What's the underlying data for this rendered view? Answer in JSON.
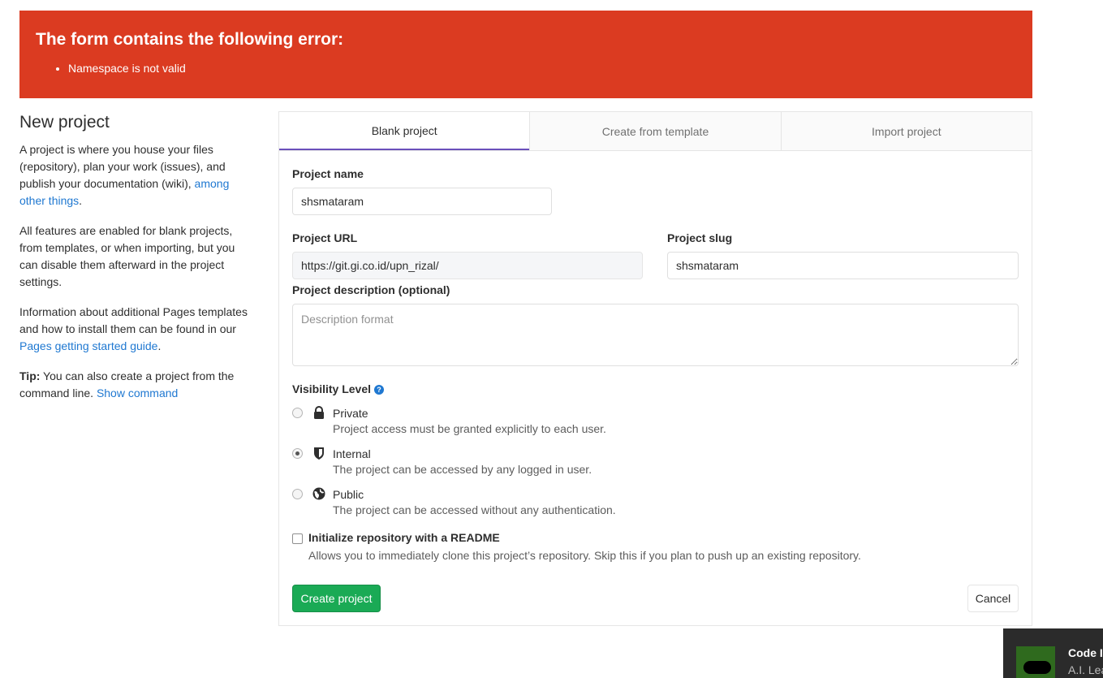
{
  "error": {
    "title": "The form contains the following error:",
    "items": [
      "Namespace is not valid"
    ]
  },
  "intro": {
    "title": "New project",
    "p1_text": "A project is where you house your files (repository), plan your work (issues), and publish your documentation (wiki), ",
    "p1_link": "among other things",
    "p1_end": ".",
    "p2": "All features are enabled for blank projects, from templates, or when importing, but you can disable them afterward in the project settings.",
    "p3_text": "Information about additional Pages templates and how to install them can be found in our ",
    "p3_link": "Pages getting started guide",
    "p3_end": ".",
    "tip_label": "Tip:",
    "tip_text": " You can also create a project from the command line. ",
    "tip_link": "Show command"
  },
  "tabs": [
    {
      "label": "Blank project",
      "active": true
    },
    {
      "label": "Create from template",
      "active": false
    },
    {
      "label": "Import project",
      "active": false
    }
  ],
  "form": {
    "project_name_label": "Project name",
    "project_name_value": "shsmataram",
    "project_url_label": "Project URL",
    "project_url_value": "https://git.gi.co.id/upn_rizal/",
    "project_slug_label": "Project slug",
    "project_slug_value": "shsmataram",
    "description_label": "Project description (optional)",
    "description_placeholder": "Description format",
    "visibility_label": "Visibility Level",
    "visibility_options": [
      {
        "title": "Private",
        "desc": "Project access must be granted explicitly to each user.",
        "icon": "lock-icon",
        "checked": false
      },
      {
        "title": "Internal",
        "desc": "The project can be accessed by any logged in user.",
        "icon": "shield-icon",
        "checked": true
      },
      {
        "title": "Public",
        "desc": "The project can be accessed without any authentication.",
        "icon": "globe-icon",
        "checked": false
      }
    ],
    "readme_label": "Initialize repository with a README",
    "readme_desc": "Allows you to immediately clone this project’s repository. Skip this if you plan to push up an existing repository.",
    "readme_checked": false,
    "create_button": "Create project",
    "cancel_button": "Cancel"
  },
  "toast": {
    "title": "Code I",
    "subtitle": "A.I. Lea"
  },
  "colors": {
    "error_bg": "#db3b21",
    "link": "#1f78d1",
    "tab_active_border": "#6b4fbb",
    "create_button": "#1aaa55"
  }
}
